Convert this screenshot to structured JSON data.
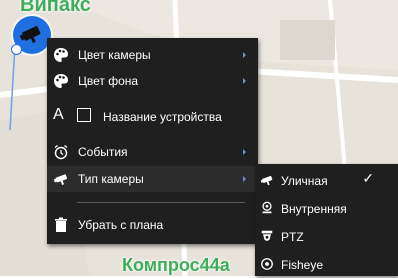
{
  "map": {
    "label_top": "Випакс",
    "label_bottom": "Компрос44а"
  },
  "context_menu": {
    "items": [
      {
        "label": "Цвет камеры",
        "icon": "palette-icon",
        "has_submenu": true
      },
      {
        "label": "Цвет фона",
        "icon": "palette-icon",
        "has_submenu": true
      },
      {
        "label": "Название устройства",
        "icon": "text-icon",
        "has_submenu": false,
        "checked": false
      },
      {
        "label": "События",
        "icon": "alarm-clock-icon",
        "has_submenu": true
      },
      {
        "label": "Тип камеры",
        "icon": "camera-icon",
        "has_submenu": true
      },
      {
        "label": "Убрать с плана",
        "icon": "trash-icon",
        "has_submenu": false
      }
    ]
  },
  "camera_type_submenu": {
    "items": [
      {
        "label": "Уличная",
        "icon": "outdoor-camera-icon",
        "selected": true
      },
      {
        "label": "Внутренняя",
        "icon": "indoor-camera-icon",
        "selected": false
      },
      {
        "label": "PTZ",
        "icon": "ptz-camera-icon",
        "selected": false
      },
      {
        "label": "Fisheye",
        "icon": "fisheye-camera-icon",
        "selected": false
      }
    ],
    "check_mark": "✓"
  },
  "colors": {
    "menu_bg": "#1f1f1f",
    "marker_blue": "#1f6fe0",
    "map_label_green": "#3fae5a"
  }
}
